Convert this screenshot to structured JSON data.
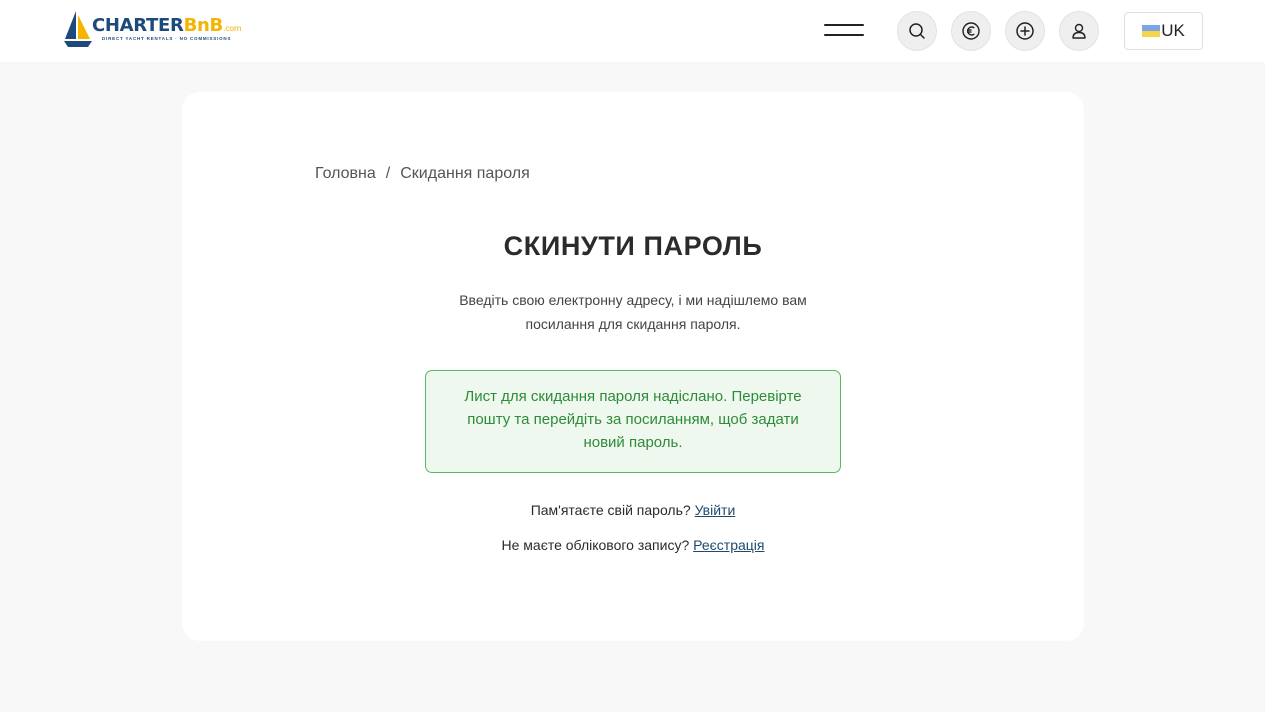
{
  "header": {
    "logo": {
      "brand_part1": "CHARTER",
      "brand_part2": "BnB",
      "brand_suffix": ".com",
      "tagline": "DIRECT YACHT RENTALS · NO COMMISSIONS"
    },
    "language": "UK",
    "icons": [
      "menu-icon",
      "search-icon",
      "euro-icon",
      "plus-circle-icon",
      "user-icon",
      "flag-ukraine-icon"
    ]
  },
  "breadcrumb": {
    "home": "Головна",
    "separator": "/",
    "current": "Скидання пароля"
  },
  "page": {
    "title": "СКИНУТИ ПАРОЛЬ",
    "subtitle": "Введіть свою електронну адресу, і ми надішлемо вам посилання для скидання пароля.",
    "alert": "Лист для скидання пароля надіслано. Перевірте пошту та перейдіть за посиланням, щоб задати новий пароль.",
    "remember_text": "Пам'ятаєте свій пароль?",
    "login_link": "Увійти",
    "no_account_text": "Не маєте облікового запису?",
    "register_link": "Реєстрація"
  },
  "colors": {
    "brand_blue": "#1d4a7a",
    "brand_yellow": "#f4b400",
    "success_text": "#2e8b37",
    "success_border": "#5cb85c",
    "success_bg": "#eff8ef",
    "page_bg": "#f8f8f8"
  }
}
